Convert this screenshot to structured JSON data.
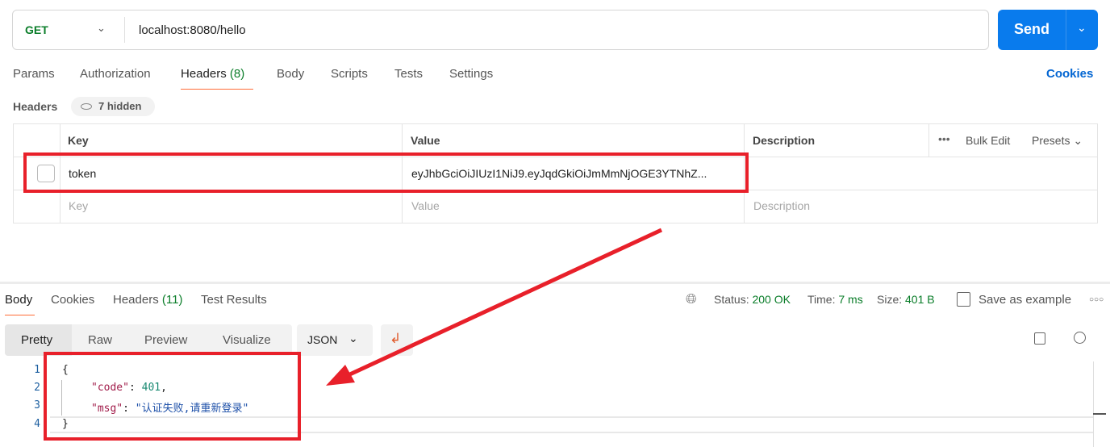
{
  "request": {
    "method": "GET",
    "url": "localhost:8080/hello",
    "send_label": "Send"
  },
  "tabs": [
    {
      "label": "Params"
    },
    {
      "label": "Authorization"
    },
    {
      "label": "Headers",
      "count": "(8)"
    },
    {
      "label": "Body"
    },
    {
      "label": "Scripts"
    },
    {
      "label": "Tests"
    },
    {
      "label": "Settings"
    }
  ],
  "cookies_link": "Cookies",
  "headers": {
    "title": "Headers",
    "hidden_label": "7 hidden",
    "columns": {
      "key": "Key",
      "value": "Value",
      "description": "Description"
    },
    "bulk_edit": "Bulk Edit",
    "presets": "Presets",
    "rows": [
      {
        "key": "token",
        "value": "eyJhbGciOiJIUzI1NiJ9.eyJqdGkiOiJmMmNjOGE3YTNhZ...",
        "checked": false
      }
    ],
    "placeholder": {
      "key": "Key",
      "value": "Value",
      "description": "Description"
    }
  },
  "response": {
    "tabs": [
      {
        "label": "Body"
      },
      {
        "label": "Cookies"
      },
      {
        "label": "Headers",
        "count": "(11)"
      },
      {
        "label": "Test Results"
      }
    ],
    "status_label": "Status:",
    "status": "200 OK",
    "time_label": "Time:",
    "time": "7 ms",
    "size_label": "Size:",
    "size": "401 B",
    "save_example": "Save as example",
    "views": [
      "Pretty",
      "Raw",
      "Preview",
      "Visualize"
    ],
    "format": "JSON",
    "lines": [
      "1",
      "2",
      "3",
      "4"
    ],
    "body": {
      "open": "{",
      "code_key": "\"code\"",
      "code_val": "401",
      "msg_key": "\"msg\"",
      "msg_val": "\"认证失败,请重新登录\"",
      "close": "}"
    }
  },
  "colors": {
    "accent": "#ff6c37",
    "send": "#097bed",
    "success": "#0a7d29",
    "annotation": "#e8202a"
  }
}
